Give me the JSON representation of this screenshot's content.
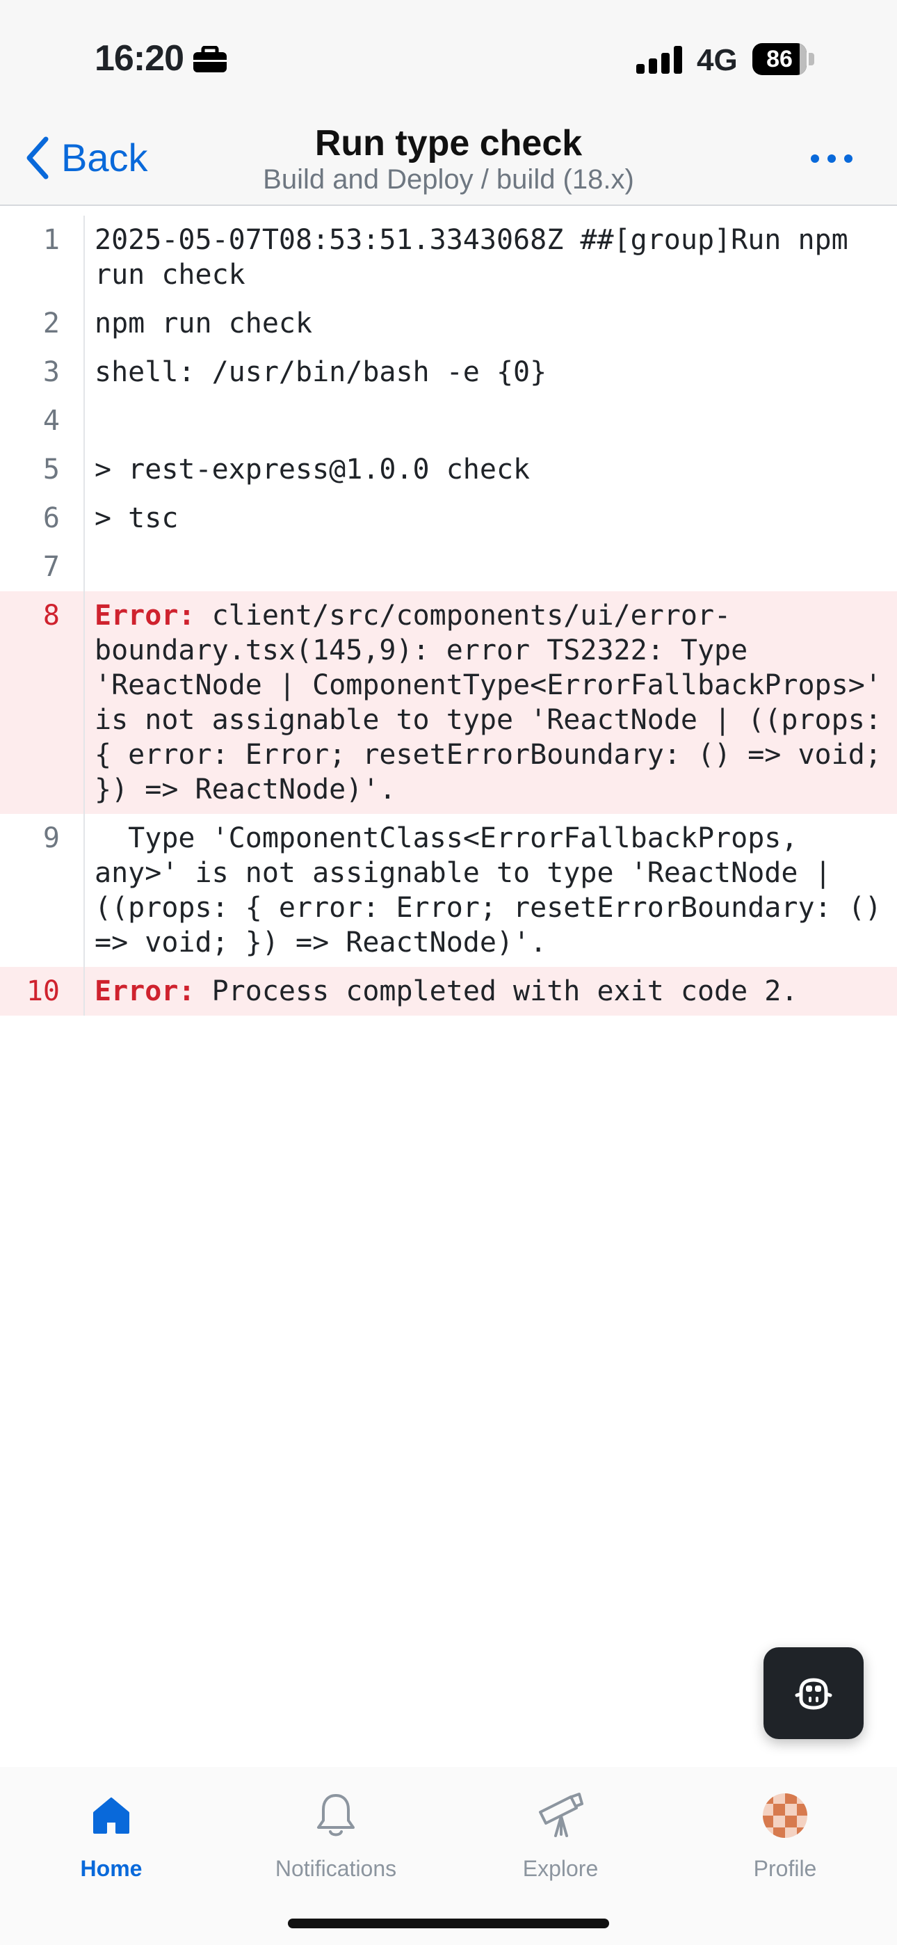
{
  "status_bar": {
    "time": "16:20",
    "network": "4G",
    "battery": "86",
    "battery_level": 0.86
  },
  "nav": {
    "back_label": "Back",
    "title": "Run type check",
    "subtitle": "Build and Deploy / build (18.x)"
  },
  "log": {
    "error_label": "Error:",
    "lines": [
      {
        "n": "1",
        "text": "2025-05-07T08:53:51.3343068Z ##[group]Run npm run check"
      },
      {
        "n": "2",
        "text": "npm run check"
      },
      {
        "n": "3",
        "text": "shell: /usr/bin/bash -e {0}"
      },
      {
        "n": "4",
        "text": ""
      },
      {
        "n": "5",
        "text": "> rest-express@1.0.0 check"
      },
      {
        "n": "6",
        "text": "> tsc"
      },
      {
        "n": "7",
        "text": ""
      },
      {
        "n": "8",
        "text": " client/src/components/ui/error-boundary.tsx(145,9): error TS2322: Type 'ReactNode | ComponentType<ErrorFallbackProps>' is not assignable to type 'ReactNode | ((props: { error: Error; resetErrorBoundary: () => void; }) => ReactNode)'."
      },
      {
        "n": "9",
        "text": "  Type 'ComponentClass<ErrorFallbackProps, any>' is not assignable to type 'ReactNode | ((props: { error: Error; resetErrorBoundary: () => void; }) => ReactNode)'."
      },
      {
        "n": "10",
        "text": " Process completed with exit code 2."
      }
    ]
  },
  "fab": {
    "icon": "copilot-icon"
  },
  "tabs": [
    {
      "label": "Home",
      "icon": "home-icon",
      "active": true
    },
    {
      "label": "Notifications",
      "icon": "bell-icon"
    },
    {
      "label": "Explore",
      "icon": "telescope-icon"
    },
    {
      "label": "Profile",
      "icon": "avatar-icon"
    }
  ],
  "colors": {
    "accent": "#0969da",
    "error": "#cf222e",
    "error_bg": "#fdeced",
    "command": "#2ea7e0"
  }
}
